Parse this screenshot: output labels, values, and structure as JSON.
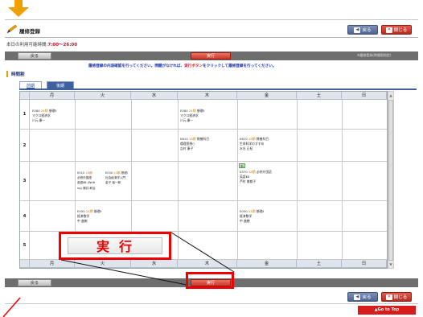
{
  "header": {
    "title": "履修登録",
    "back_label": "戻る",
    "close_label": "閉じる",
    "available_time_prefix": "本日の利用可能時間:",
    "available_time_value": "7:00〜26:00"
  },
  "action_bar": {
    "back_label": "戻る",
    "execute_label": "実行",
    "note": "※履修登録(時間割指定)"
  },
  "instruction": {
    "part1": "履修登録の内容確認を行ってください。問題がなければ、",
    "highlight": "実行ボタン",
    "part2": "をクリックして履修登録を行ってください。"
  },
  "section_title": "時間割",
  "tabs": [
    {
      "label": "前期"
    },
    {
      "label": "後期"
    }
  ],
  "days": [
    "月",
    "火",
    "水",
    "木",
    "金",
    "土",
    "日"
  ],
  "periods": [
    "1",
    "2",
    "3",
    "4",
    "5"
  ],
  "courses": {
    "p1_mon": {
      "code": "E060",
      "yr": "24期",
      "type": "基礎Ⅱ",
      "name": "マクロ経済学",
      "teacher": "川元 康一"
    },
    "p1_thu": {
      "code": "E060",
      "yr": "24期",
      "type": "基礎Ⅱ",
      "name": "マクロ経済学",
      "teacher": "川元 康一"
    },
    "p2_thu": {
      "code": "K610",
      "yr": "18期",
      "type": "教養科目",
      "name": "倫理思想○",
      "teacher": "吉村 康子"
    },
    "p2_fri": {
      "code": "K610",
      "yr": "18期",
      "type": "教養科目",
      "name": "生命科学のすすめ",
      "teacher": "水谷 正紀"
    },
    "p3_tue_a": {
      "code": "K510",
      "yr": "18期",
      "type": "必修外国語",
      "name": "英語ⅡB (Writi",
      "teacher": "ng)  梶井 和治"
    },
    "p3_tue_b": {
      "code": "E030",
      "yr": "24期",
      "type": "基礎Ⅰ",
      "name": "社会経済学入門",
      "teacher": "金子 裕一郎"
    },
    "p3_fri": {
      "code": "K570",
      "yr": "18期",
      "type": "必修外国語",
      "name": "英語ⅡD",
      "teacher": "芦村 美都子"
    },
    "p4_tue": {
      "code": "E050",
      "yr": "24期",
      "type": "基礎Ⅱ",
      "name": "経済数学",
      "teacher": "中 進樹"
    },
    "p4_fri": {
      "code": "E050",
      "yr": "24期",
      "type": "基礎Ⅱ",
      "name": "経済数学",
      "teacher": "中 進樹"
    }
  },
  "badge_new": "新",
  "callout": {
    "label": "実行"
  },
  "footer": {
    "back_label": "戻る",
    "close_label": "閉じる",
    "go_top_label": "▲Go to Top"
  }
}
